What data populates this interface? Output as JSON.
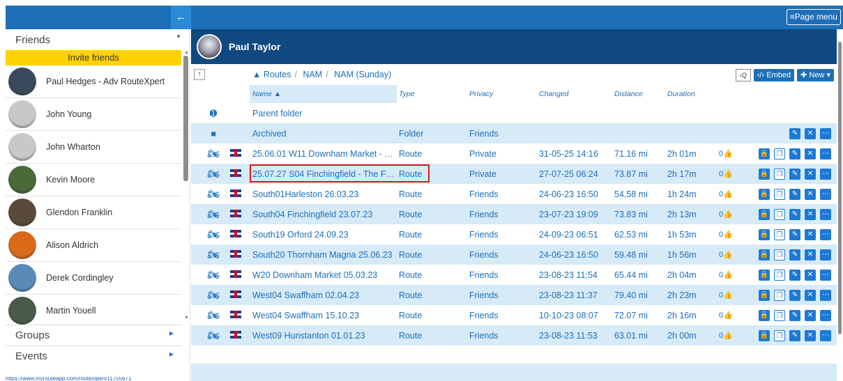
{
  "topbar": {
    "page_menu_label": "≡Page menu",
    "collapse_icon": "←"
  },
  "sidebar": {
    "friends_title": "Friends",
    "invite_label": "Invite friends",
    "friends": [
      {
        "name": "Paul Hedges - Adv RouteXpert",
        "avatar_color": "#3a4a5c"
      },
      {
        "name": "John Young",
        "avatar_color": "#c8c8c8"
      },
      {
        "name": "John Wharton",
        "avatar_color": "#c8c8c8"
      },
      {
        "name": "Kevin Moore",
        "avatar_color": "#4a6a3a"
      },
      {
        "name": "Glendon Franklin",
        "avatar_color": "#5a4a3a"
      },
      {
        "name": "Alison Aldrich",
        "avatar_color": "#d86a1a"
      },
      {
        "name": "Derek Cordingley",
        "avatar_color": "#5a8ab8"
      },
      {
        "name": "Martin Youell",
        "avatar_color": "#4a5a4a"
      }
    ],
    "groups_label": "Groups",
    "events_label": "Events",
    "status_url": "https://www.myrouteapp.com/route/open/11755671"
  },
  "header": {
    "user_name": "Paul Taylor"
  },
  "toolbar": {
    "breadcrumbs": [
      "Routes",
      "NAM",
      "NAM (Sunday)"
    ],
    "embed_label": "‹/› Embed",
    "new_label": "✚ New ▾",
    "search_icon": "‹Q"
  },
  "table": {
    "headers": {
      "name": "Name ▲",
      "type": "Type",
      "privacy": "Privacy",
      "changed": "Changed",
      "distance": "Distance",
      "duration": "Duration"
    },
    "parent_folder": "Parent folder",
    "folder": {
      "name": "Archived",
      "type": "Folder",
      "privacy": "Friends"
    },
    "routes": [
      {
        "name": "25.06.01 W11 Downham Market - Ar...",
        "type": "Route",
        "privacy": "Private",
        "changed": "31-05-25 14:16",
        "distance": "71.16 mi",
        "duration": "2h 01m",
        "likes": "0"
      },
      {
        "name": "25.07.27 S04 Finchingfield - The Fox I...",
        "type": "Route",
        "privacy": "Private",
        "changed": "27-07-25 06:24",
        "distance": "73.87 mi",
        "duration": "2h 17m",
        "likes": "0"
      },
      {
        "name": "South01Harleston 26.03.23",
        "type": "Route",
        "privacy": "Friends",
        "changed": "24-06-23 16:50",
        "distance": "54.58 mi",
        "duration": "1h 24m",
        "likes": "0"
      },
      {
        "name": "South04 Finchingfield 23.07.23",
        "type": "Route",
        "privacy": "Friends",
        "changed": "23-07-23 19:09",
        "distance": "73.83 mi",
        "duration": "2h 13m",
        "likes": "0"
      },
      {
        "name": "South19 Orford 24.09.23",
        "type": "Route",
        "privacy": "Friends",
        "changed": "24-09-23 06:51",
        "distance": "62.53 mi",
        "duration": "1h 53m",
        "likes": "0"
      },
      {
        "name": "South20 Thornham Magna 25.06.23",
        "type": "Route",
        "privacy": "Friends",
        "changed": "24-06-23 16:50",
        "distance": "59.48 mi",
        "duration": "1h 56m",
        "likes": "0"
      },
      {
        "name": "W20 Downham Market 05.03.23",
        "type": "Route",
        "privacy": "Friends",
        "changed": "23-08-23 11:54",
        "distance": "65.44 mi",
        "duration": "2h 04m",
        "likes": "0"
      },
      {
        "name": "West04 Swaffham 02.04.23",
        "type": "Route",
        "privacy": "Friends",
        "changed": "23-08-23 11:37",
        "distance": "79.40 mi",
        "duration": "2h 23m",
        "likes": "0"
      },
      {
        "name": "West04 Swaffham 15.10.23",
        "type": "Route",
        "privacy": "Friends",
        "changed": "10-10-23 08:07",
        "distance": "72.07 mi",
        "duration": "2h 16m",
        "likes": "0"
      },
      {
        "name": "West09 Hunstanton 01.01.23",
        "type": "Route",
        "privacy": "Friends",
        "changed": "23-08-23 11:53",
        "distance": "63.01 mi",
        "duration": "2h 00m",
        "likes": "0"
      }
    ]
  },
  "colors": {
    "accent": "#1d6fb8",
    "header_bg": "#10497f",
    "invite_bg": "#ffd200",
    "highlight": "#e01818",
    "row_alt": "#d6eaf8"
  }
}
